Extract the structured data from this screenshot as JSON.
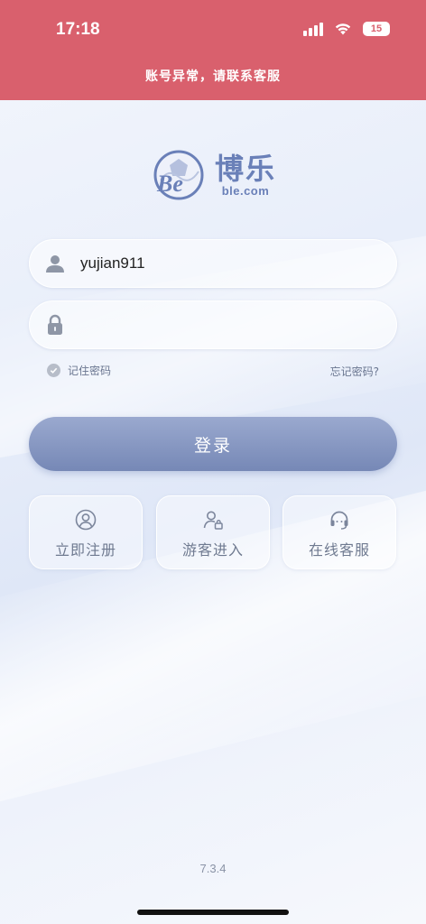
{
  "status_bar": {
    "time": "17:18",
    "battery": "15"
  },
  "banner": {
    "text": "账号异常，请联系客服"
  },
  "logo": {
    "name_cn": "博乐",
    "domain": "ble.com",
    "mark_letters": "Be"
  },
  "login": {
    "username_value": "yujian911",
    "password_value": "",
    "remember_label": "记住密码",
    "forgot_label": "忘记密码?",
    "submit_label": "登录"
  },
  "actions": [
    {
      "label": "立即注册",
      "icon": "user-circle-icon"
    },
    {
      "label": "游客进入",
      "icon": "guest-user-icon"
    },
    {
      "label": "在线客服",
      "icon": "headset-icon"
    }
  ],
  "footer": {
    "version": "7.3.4"
  },
  "colors": {
    "header": "#d9606d",
    "button": "#7688b6",
    "logo": "#6a80b8"
  }
}
